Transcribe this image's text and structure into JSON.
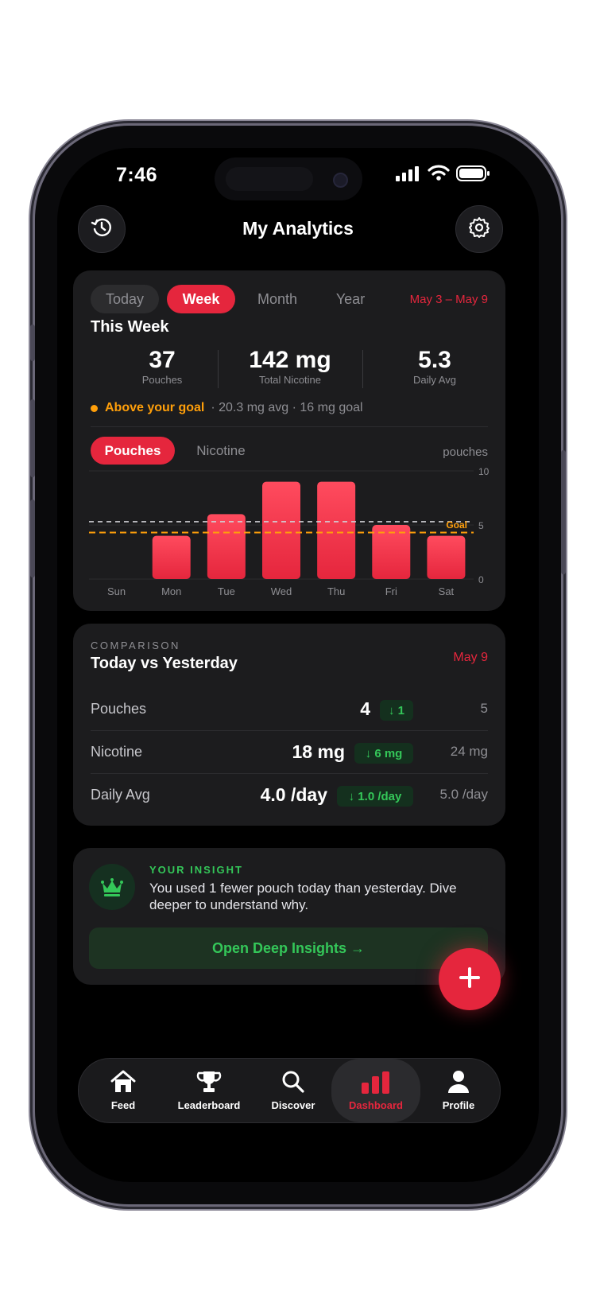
{
  "status": {
    "time": "7:46"
  },
  "header": {
    "title": "My Analytics",
    "history_icon": "history-icon",
    "settings_icon": "gear-icon"
  },
  "period": {
    "tabs": [
      "Today",
      "Week",
      "Month",
      "Year"
    ],
    "selected": "Week",
    "range": "May 3 – May 9",
    "heading": "This Week"
  },
  "stats": [
    {
      "value": "37",
      "label": "Pouches"
    },
    {
      "value": "142 mg",
      "label": "Total Nicotine"
    },
    {
      "value": "5.3",
      "label": "Daily Avg"
    }
  ],
  "goal_status": {
    "label": "Above your goal",
    "detail": "· 20.3 mg avg · 16 mg goal",
    "color": "#ff9f0a"
  },
  "chart_toggle": {
    "options": [
      "Pouches",
      "Nicotine"
    ],
    "selected": "Pouches",
    "unit": "pouches"
  },
  "chart_data": {
    "type": "bar",
    "categories": [
      "Sun",
      "Mon",
      "Tue",
      "Wed",
      "Thu",
      "Fri",
      "Sat"
    ],
    "values": [
      0,
      4,
      6,
      9,
      9,
      5,
      4
    ],
    "ylim": [
      0,
      10
    ],
    "yticks": [
      0,
      5,
      10
    ],
    "goal_value": 4.3,
    "goal_label": "Goal",
    "average_value": 5.3,
    "bar_color": "#e5263d",
    "goal_color": "#ff9f0a"
  },
  "comparison": {
    "kicker": "COMPARISON",
    "title": "Today vs Yesterday",
    "date": "May 9",
    "rows": [
      {
        "label": "Pouches",
        "today": "4",
        "delta": "↓ 1",
        "yesterday": "5"
      },
      {
        "label": "Nicotine",
        "today": "18 mg",
        "delta": "↓ 6 mg",
        "yesterday": "24 mg"
      },
      {
        "label": "Daily Avg",
        "today": "4.0 /day",
        "delta": "↓ 1.0 /day",
        "yesterday": "5.0 /day"
      }
    ]
  },
  "insight": {
    "kicker": "YOUR INSIGHT",
    "text": "You used 1 fewer pouch today than yesterday. Dive deeper to understand why.",
    "button": "Open Deep Insights →",
    "icon": "crown-icon"
  },
  "fab": {
    "icon": "plus-icon"
  },
  "nav": [
    {
      "label": "Feed",
      "icon": "home-icon"
    },
    {
      "label": "Leaderboard",
      "icon": "trophy-icon"
    },
    {
      "label": "Discover",
      "icon": "search-icon"
    },
    {
      "label": "Dashboard",
      "icon": "bar-chart-icon",
      "active": true
    },
    {
      "label": "Profile",
      "icon": "person-icon"
    }
  ],
  "colors": {
    "accent": "#e5263d",
    "positive": "#34c759",
    "warning": "#ff9f0a",
    "card": "#1c1c1e"
  }
}
